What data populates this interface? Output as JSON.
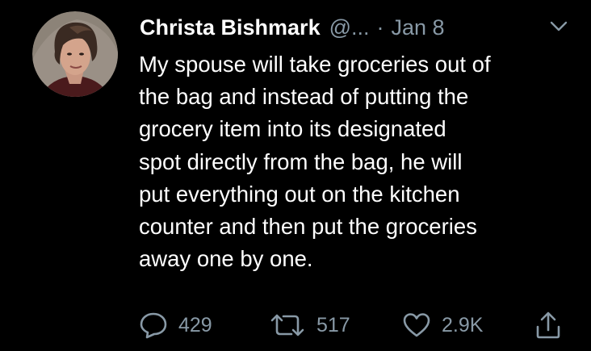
{
  "tweet": {
    "author_name": "Christa Bishmark",
    "handle": "@...",
    "separator": "·",
    "date": "Jan 8",
    "lines": [
      "My spouse will take groceries out of",
      "the bag and instead of putting the",
      "grocery item into its designated",
      "spot directly from the bag, he will",
      "put everything out on the kitchen",
      "counter and then put the groceries",
      "away one by one."
    ]
  },
  "actions": {
    "reply_count": "429",
    "retweet_count": "517",
    "like_count": "2.9K"
  },
  "icons": {
    "avatar": "profile-photo",
    "menu": "chevron-down-icon",
    "reply": "speech-bubble-icon",
    "retweet": "retweet-arrows-icon",
    "like": "heart-icon",
    "share": "share-arrow-up-icon"
  },
  "colors": {
    "background": "#000000",
    "text": "#ffffff",
    "muted": "#8899a6"
  }
}
